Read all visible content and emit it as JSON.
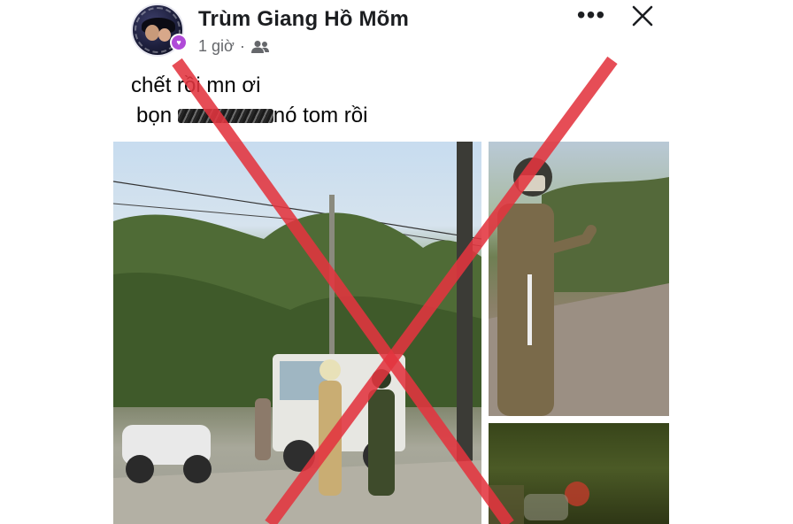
{
  "post": {
    "author": "Trùm Giang Hồ Mõm",
    "time": "1 giờ",
    "separator": "·",
    "audience_icon": "friends-icon",
    "more_icon": "more-horizontal-icon",
    "more_label": "•••",
    "close_icon": "close-icon",
    "text_line1": "chết rồi mn ơi",
    "text_line2_prefix": "bọn",
    "text_line2_suffix": "nó tom rồi"
  },
  "photos": {
    "count": 3
  },
  "overlay": {
    "x_mark_color": "#e2343f"
  }
}
